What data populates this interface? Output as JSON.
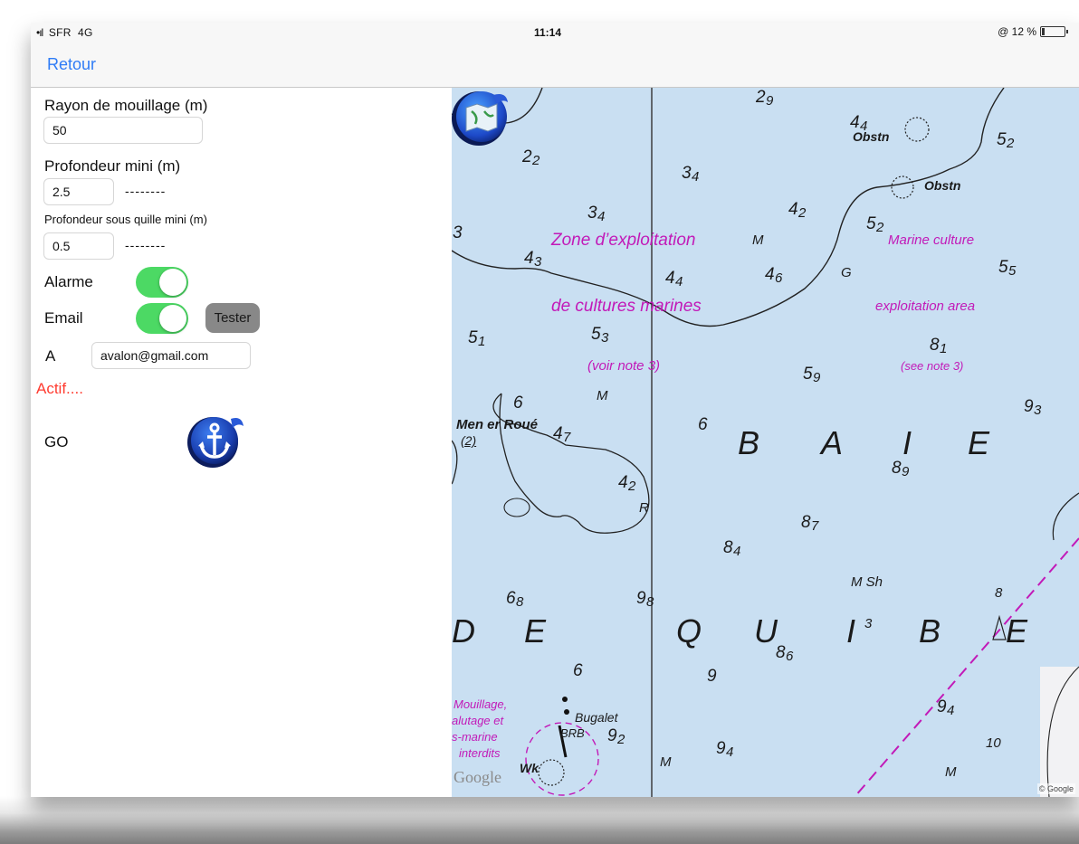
{
  "status_bar": {
    "carrier": "SFR",
    "network": "4G",
    "time": "11:14",
    "battery_text": "@ 12 %",
    "battery_level": 0.12
  },
  "nav": {
    "back_label": "Retour"
  },
  "form": {
    "radius_label": "Rayon de mouillage (m)",
    "radius_value": "50",
    "min_depth_label": "Profondeur mini (m)",
    "min_depth_value": "2.5",
    "min_depth_readout": "--------",
    "keel_depth_label": "Profondeur sous quille mini (m)",
    "keel_depth_value": "0.5",
    "keel_depth_readout": "--------",
    "alarm_label": "Alarme",
    "alarm_on": true,
    "email_label": "Email",
    "email_on": true,
    "tester_label": "Tester",
    "to_label": "A",
    "email_value": "avalon@gmail.com",
    "status_text": "Actif....",
    "go_label": "GO",
    "go_icon": "anchor-icon"
  },
  "map": {
    "logo_icon": "nautical-chart-app-icon",
    "zone_fr_1": "Zone d’exploitation",
    "zone_fr_2": "de cultures marines",
    "zone_fr_note": "(voir note 3)",
    "zone_en_1": "Marine culture",
    "zone_en_2": "exploitation area",
    "zone_en_note": "(see note 3)",
    "mouillage_1": "Mouillage,",
    "mouillage_2": "alutage et",
    "mouillage_3": "s-marine",
    "mouillage_4": "interdits",
    "place_1": "Men er Roué",
    "place_1_sub": "(2)",
    "place_2": "Bugalet",
    "place_2_sub": "BRB",
    "wreck": "Wk",
    "obstn": "Obstn",
    "seabed_M": "M",
    "seabed_G": "G",
    "seabed_R": "R",
    "seabed_MSh": "M Sh",
    "baie_B": "B",
    "baie_A": "A",
    "baie_I": "I",
    "baie_E": "E",
    "quib_D": "D",
    "quib_E1": "E",
    "quib_Q": "Q",
    "quib_U": "U",
    "quib_I": "I",
    "quib_B": "B",
    "quib_E2": "E",
    "google": "Google",
    "copyright": "© Google",
    "soundings": {
      "s1": "2",
      "s2": "9",
      "s3": "4",
      "s4": "4",
      "s5": "5",
      "s6": "2",
      "s7": "2",
      "s8": "2",
      "s9": "3",
      "s10": "4",
      "s11": "3",
      "s12": "4",
      "s13": "4",
      "s14": "2",
      "s15": "5",
      "s16": "2",
      "s17": "4",
      "s18": "3",
      "s19": "4",
      "s20": "4",
      "s21": "4",
      "s22": "6",
      "s23": "5",
      "s24": "5",
      "s25": "5",
      "s26": "1",
      "s27": "5",
      "s28": "3",
      "s29": "5",
      "s30": "9",
      "s31": "8",
      "s32": "1",
      "s33": "9",
      "s34": "3",
      "s35": "4",
      "s36": "7",
      "s37": "6",
      "s38": "8",
      "s39": "9",
      "s40": "4",
      "s41": "2",
      "s42": "8",
      "s43": "7",
      "s44": "8",
      "s45": "4",
      "s46": "6",
      "s47": "8",
      "s48": "9",
      "s49": "8",
      "s50": "3",
      "s51": "8",
      "s52": "6",
      "s53": "8",
      "s54": "6",
      "s55": "9",
      "s56": "9",
      "s57": "4",
      "s58": "9",
      "s59": "2",
      "s60": "9",
      "s61": "4",
      "s62": "8",
      "s63": "10",
      "s64": "3",
      "s65": "6"
    }
  }
}
